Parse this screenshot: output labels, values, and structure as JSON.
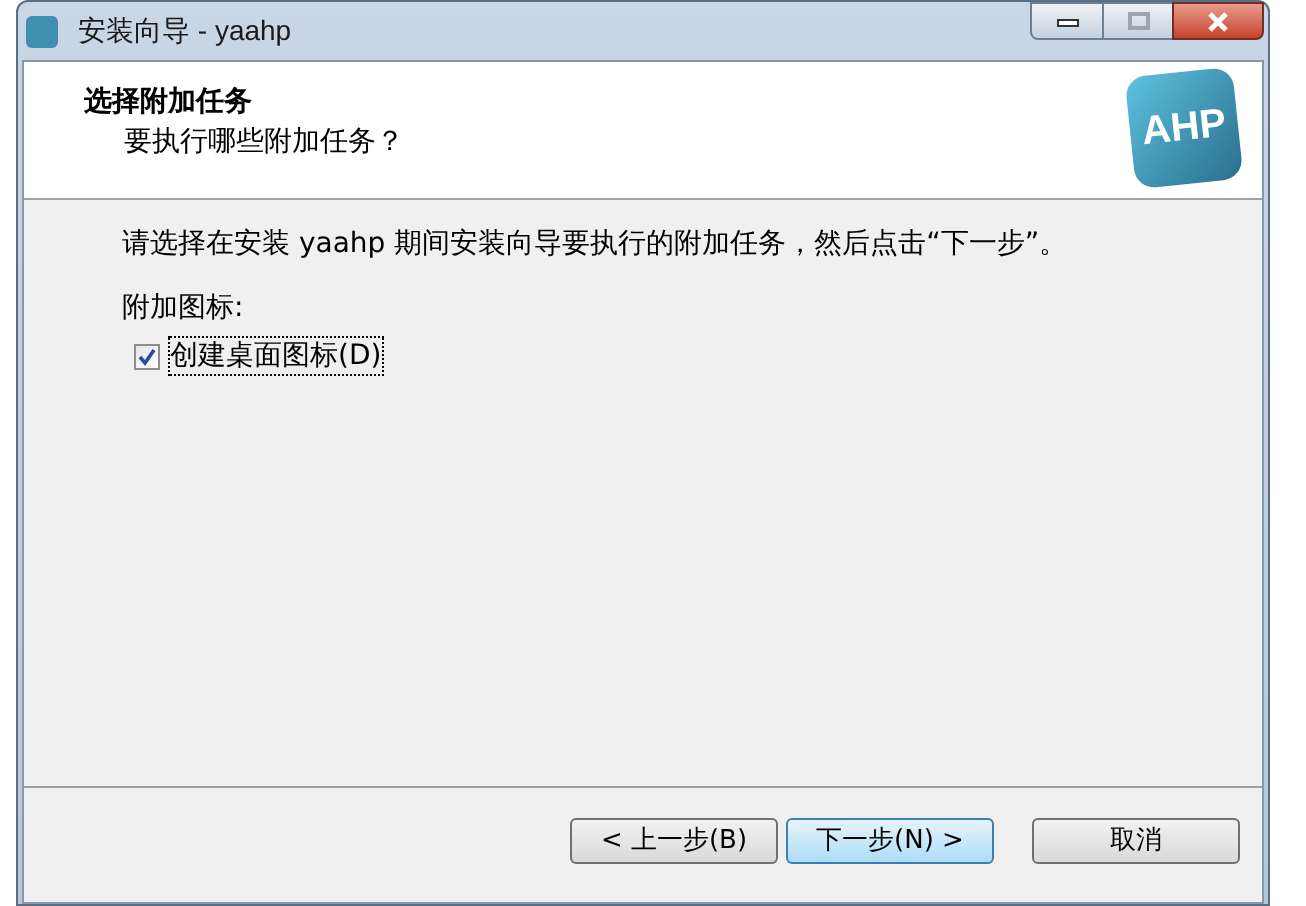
{
  "window": {
    "title": "安装向导 - yaahp"
  },
  "header": {
    "title": "选择附加任务",
    "subtitle": "要执行哪些附加任务？",
    "logo": "AHP"
  },
  "instruction": "请选择在安装 yaahp 期间安装向导要执行的附加任务，然后点击“下一步”。",
  "group_label": "附加图标:",
  "options": [
    {
      "label": "创建桌面图标(D)",
      "checked": true,
      "focused": true
    }
  ],
  "buttons": [
    {
      "label": "< 上一步(B)",
      "default": false
    },
    {
      "label": "下一步(N) >",
      "default": true
    },
    {
      "label": "取消",
      "default": false
    }
  ]
}
